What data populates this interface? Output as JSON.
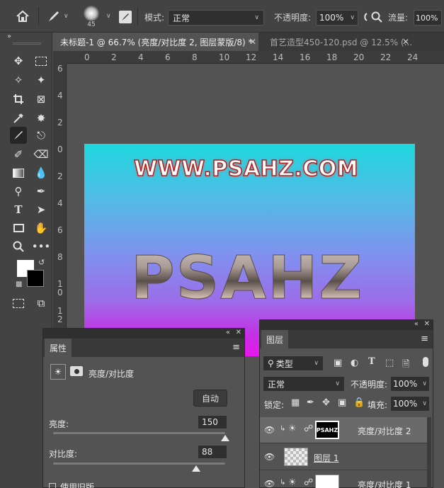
{
  "options": {
    "brush_size": "45",
    "mode_label": "模式:",
    "mode_value": "正常",
    "opacity_label": "不透明度:",
    "opacity_value": "100%",
    "flow_label": "流量:",
    "flow_value": "100%"
  },
  "tabs": [
    {
      "label": "未标题-1 @ 66.7% (亮度/对比度 2, 图层蒙版/8) *",
      "active": true
    },
    {
      "label": "首艺造型450-120.psd @ 12.5% (...",
      "active": false
    }
  ],
  "ruler_top": [
    "0",
    "2",
    "4",
    "6",
    "8",
    "10",
    "12",
    "14",
    "16",
    "18",
    "20",
    "22",
    "24"
  ],
  "ruler_left": [
    "6",
    "4",
    "2",
    "0",
    "2",
    "4",
    "6",
    "8",
    "10",
    "12"
  ],
  "canvas": {
    "url_text": "WWW.PSAHZ.COM",
    "logo_text": "PSAHZ"
  },
  "properties": {
    "tab": "属性",
    "adjustment_name": "亮度/对比度",
    "auto_button": "自动",
    "brightness_label": "亮度:",
    "brightness_value": "150",
    "brightness_fraction": 1.0,
    "contrast_label": "对比度:",
    "contrast_value": "88",
    "contrast_fraction": 0.83,
    "legacy_label": "使用旧版"
  },
  "layers": {
    "tab": "图层",
    "filter_kind": "类型",
    "blend_mode": "正常",
    "opacity_label": "不透明度:",
    "opacity_value": "100%",
    "lock_label": "锁定:",
    "fill_label": "填充:",
    "fill_value": "100%",
    "items": [
      {
        "name": "亮度/对比度 2",
        "selected": true
      },
      {
        "name": "图层 1",
        "selected": false
      },
      {
        "name": "亮度/对比度 1",
        "selected": false
      }
    ]
  },
  "colors": {
    "foreground": "#ffffff",
    "background": "#000000",
    "canvas_top": "#1fd8de",
    "canvas_bottom": "#e815ee"
  }
}
